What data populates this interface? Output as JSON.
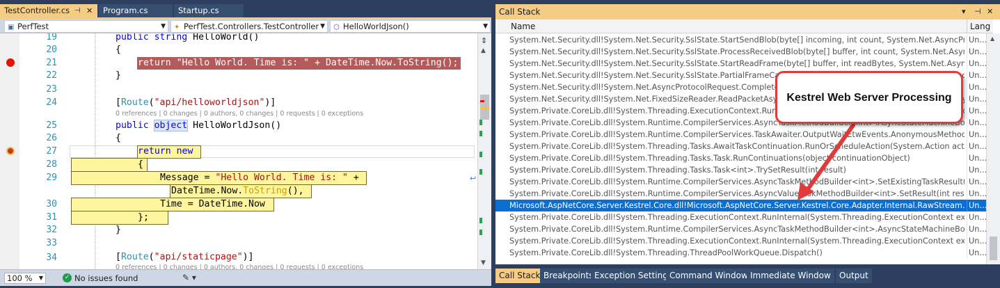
{
  "editor": {
    "tabs": [
      {
        "label": "TestController.cs",
        "pin": "⊣",
        "close": "✕"
      },
      {
        "label": "Program.cs"
      },
      {
        "label": "Startup.cs"
      }
    ],
    "nav": {
      "project": "PerfTest",
      "class": "PerfTest.Controllers.TestController",
      "member": "HelloWorldJson()"
    },
    "line_numbers": [
      "19",
      "20",
      "21",
      "22",
      "23",
      "24",
      "25",
      "26",
      "27",
      "28",
      "29",
      "30",
      "31",
      "32",
      "33",
      "34"
    ],
    "code": {
      "l19a": "public ",
      "l19b": "string",
      "l19c": " HelloWorld()",
      "l20": "{",
      "l21": "return \"Hello World. Time is: \" + DateTime.Now.ToString();",
      "l22": "}",
      "l24a": "[",
      "l24b": "Route",
      "l24c": "(",
      "l24d": "\"api/helloworldjson\"",
      "l24e": ")]",
      "lens": "0 references | 0 changes | 0 authors, 0 changes | 0 requests | 0 exceptions",
      "l25a": "public ",
      "l25b": "object",
      "l25c": " HelloWorldJson()",
      "l26": "{",
      "l27a": "return",
      "l27b": " new",
      "l28": "{",
      "l29a": "Message = ",
      "l29b": "\"Hello World. Time is: \"",
      "l29c": " +",
      "l29d": "DateTime.Now.",
      "l29e": "ToString",
      "l29f": "(),",
      "l30": "Time = DateTime.Now",
      "l31": "};",
      "l32": "}",
      "l34a": "[",
      "l34b": "Route",
      "l34c": "(",
      "l34d": "\"api/staticpage\"",
      "l34e": ")]"
    },
    "status": {
      "zoom": "100 %",
      "issues": "No issues found"
    }
  },
  "callstack": {
    "title": "Call Stack",
    "controls": {
      "dropdown": "▾",
      "pin": "⊣",
      "close": "✕"
    },
    "columns": {
      "name": "Name",
      "lang": "Lang"
    },
    "rows": [
      {
        "name": "System.Net.Security.dll!System.Net.Security.SslState.StartSendBlob(byte[] incoming, int count, System.Net.AsyncProtocol...",
        "lang": "Un..."
      },
      {
        "name": "System.Net.Security.dll!System.Net.Security.SslState.ProcessReceivedBlob(byte[] buffer, int count, System.Net.AsyncProto...",
        "lang": "Un..."
      },
      {
        "name": "System.Net.Security.dll!System.Net.Security.SslState.StartReadFrame(byte[] buffer, int readBytes, System.Net.AsyncProto...",
        "lang": "Un..."
      },
      {
        "name": "System.Net.Security.dll!System.Net.Security.SslState.PartialFrameCallback(System.Net.AsyncProtocolRequest asyncRe...",
        "lang": "Un..."
      },
      {
        "name": "System.Net.Security.dll!System.Net.AsyncProtocolRequest.CompleteRequest(int result)",
        "lang": "Un..."
      },
      {
        "name": "System.Net.Security.dll!System.Net.FixedSizeReader.ReadPacketAsync(System.IO.Stream transport, System.Net.AsyncPr...",
        "lang": "Un..."
      },
      {
        "name": "System.Private.CoreLib.dll!System.Threading.ExecutionContext.RunInternal(System.Threading.ExecutionContext executio...",
        "lang": "Un..."
      },
      {
        "name": "System.Private.CoreLib.dll!System.Runtime.CompilerServices.AsyncTaskMethodBuilder<int>.AsyncStateMachineBox<Mi...",
        "lang": "Un..."
      },
      {
        "name": "System.Private.CoreLib.dll!System.Runtime.CompilerServices.TaskAwaiter.OutputWaitEtwEvents.AnonymousMethod__12_...",
        "lang": "Un..."
      },
      {
        "name": "System.Private.CoreLib.dll!System.Threading.Tasks.AwaitTaskContinuation.RunOrScheduleAction(System.Action action, b...",
        "lang": "Un..."
      },
      {
        "name": "System.Private.CoreLib.dll!System.Threading.Tasks.Task.RunContinuations(object continuationObject)",
        "lang": "Un..."
      },
      {
        "name": "System.Private.CoreLib.dll!System.Threading.Tasks.Task<int>.TrySetResult(int result)",
        "lang": "Un..."
      },
      {
        "name": "System.Private.CoreLib.dll!System.Runtime.CompilerServices.AsyncTaskMethodBuilder<int>.SetExistingTaskResult(int res...",
        "lang": "Un..."
      },
      {
        "name": "System.Private.CoreLib.dll!System.Runtime.CompilerServices.AsyncValueTaskMethodBuilder<int>.SetResult(int result)",
        "lang": "Un..."
      },
      {
        "name": "Microsoft.AspNetCore.Server.Kestrel.Core.dll!Microsoft.AspNetCore.Server.Kestrel.Core.Adapter.Internal.RawStream.Read...",
        "lang": "Un...",
        "selected": true
      },
      {
        "name": "System.Private.CoreLib.dll!System.Threading.ExecutionContext.RunInternal(System.Threading.ExecutionContext execution...",
        "lang": "Un..."
      },
      {
        "name": "System.Private.CoreLib.dll!System.Runtime.CompilerServices.AsyncTaskMethodBuilder<int>.AsyncStateMachineBox<Mic...",
        "lang": "Un..."
      },
      {
        "name": "System.Private.CoreLib.dll!System.Threading.ExecutionContext.RunInternal(System.Threading.ExecutionContext execution...",
        "lang": "Un..."
      },
      {
        "name": "System.Private.CoreLib.dll!System.Threading.ThreadPoolWorkQueue.Dispatch()",
        "lang": "Un..."
      }
    ],
    "bottom_tabs": [
      "Call Stack",
      "Breakpoints",
      "Exception Settings",
      "Command Window",
      "Immediate Window",
      "Output"
    ]
  },
  "annotation": {
    "text": "Kestrel Web Server Processing",
    "color": "#e03b3b"
  },
  "colors": {
    "tab_active": "#f5cc84",
    "selection": "#0b6fd1",
    "breakpoint": "#e51400",
    "current_statement": "#fff59c"
  }
}
